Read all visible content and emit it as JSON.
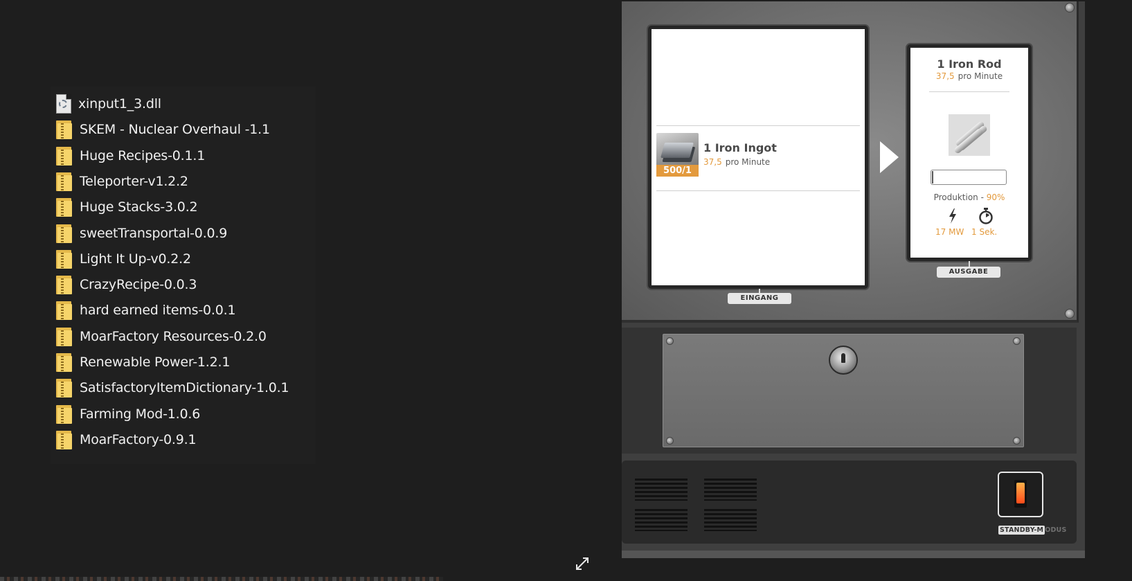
{
  "files": [
    {
      "name": "xinput1_3.dll",
      "type": "dll"
    },
    {
      "name": "SKEM - Nuclear Overhaul -1.1",
      "type": "zip"
    },
    {
      "name": "Huge Recipes-0.1.1",
      "type": "zip"
    },
    {
      "name": "Teleporter-v1.2.2",
      "type": "zip"
    },
    {
      "name": "Huge Stacks-3.0.2",
      "type": "zip"
    },
    {
      "name": "sweetTransportal-0.0.9",
      "type": "zip"
    },
    {
      "name": "Light It Up-v0.2.2",
      "type": "zip"
    },
    {
      "name": "CrazyRecipe-0.0.3",
      "type": "zip"
    },
    {
      "name": "hard earned items-0.0.1",
      "type": "zip"
    },
    {
      "name": "MoarFactory Resources-0.2.0",
      "type": "zip"
    },
    {
      "name": "Renewable Power-1.2.1",
      "type": "zip"
    },
    {
      "name": "SatisfactoryItemDictionary-1.0.1",
      "type": "zip"
    },
    {
      "name": "Farming Mod-1.0.6",
      "type": "zip"
    },
    {
      "name": "MoarFactory-0.9.1",
      "type": "zip"
    }
  ],
  "machine": {
    "input": {
      "label": "EINGANG",
      "item_name": "1 Iron Ingot",
      "rate_value": "37,5",
      "rate_unit": "pro Minute",
      "stack_badge": "500/1",
      "icon": "iron-ingot-icon"
    },
    "output": {
      "label": "AUSGABE",
      "item_name": "1 Iron Rod",
      "rate_value": "37,5",
      "rate_unit": "pro Minute",
      "icon": "iron-rod-icon",
      "progress": 0.02,
      "production_label": "Produktion -",
      "production_pct": "90%",
      "power": "17 MW",
      "cycle_time": "1 Sek."
    },
    "standby": {
      "label_lit": "STANDBY-M",
      "label_dim": "ODUS"
    }
  },
  "colors": {
    "accent": "#e39a3d",
    "folder": "#f6d46a",
    "background": "#1e1e1e"
  }
}
